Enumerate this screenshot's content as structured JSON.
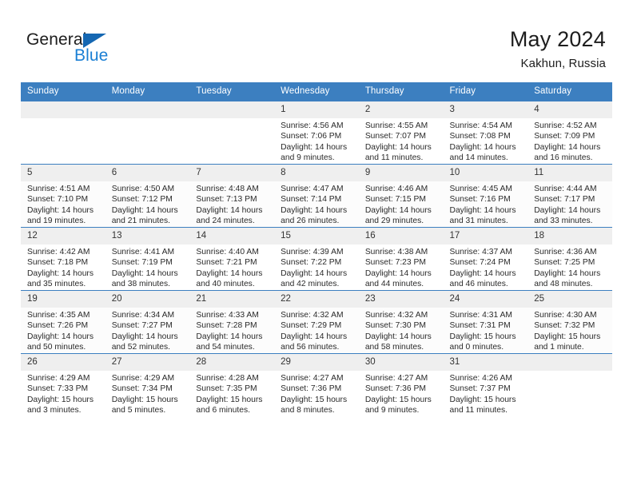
{
  "brand": {
    "name_part1": "General",
    "name_part2": "Blue",
    "triangle_color": "#1567b2",
    "blue_color": "#1a7fd4"
  },
  "title": {
    "month_year": "May 2024",
    "location": "Kakhun, Russia"
  },
  "theme": {
    "header_bg": "#3c7fc0",
    "header_text": "#ffffff",
    "daynum_bg": "#efefef",
    "row_alt_bg": "#fcfcfc",
    "grid_line": "#3c7fc0"
  },
  "weekdays": [
    "Sunday",
    "Monday",
    "Tuesday",
    "Wednesday",
    "Thursday",
    "Friday",
    "Saturday"
  ],
  "labels": {
    "sunrise_prefix": "Sunrise:",
    "sunset_prefix": "Sunset:",
    "daylight_prefix": "Daylight:"
  },
  "weeks": [
    [
      {
        "day": "",
        "empty": true
      },
      {
        "day": "",
        "empty": true
      },
      {
        "day": "",
        "empty": true
      },
      {
        "day": "1",
        "sunrise": "Sunrise: 4:56 AM",
        "sunset": "Sunset: 7:06 PM",
        "daylight_l1": "Daylight: 14 hours",
        "daylight_l2": "and 9 minutes."
      },
      {
        "day": "2",
        "sunrise": "Sunrise: 4:55 AM",
        "sunset": "Sunset: 7:07 PM",
        "daylight_l1": "Daylight: 14 hours",
        "daylight_l2": "and 11 minutes."
      },
      {
        "day": "3",
        "sunrise": "Sunrise: 4:54 AM",
        "sunset": "Sunset: 7:08 PM",
        "daylight_l1": "Daylight: 14 hours",
        "daylight_l2": "and 14 minutes."
      },
      {
        "day": "4",
        "sunrise": "Sunrise: 4:52 AM",
        "sunset": "Sunset: 7:09 PM",
        "daylight_l1": "Daylight: 14 hours",
        "daylight_l2": "and 16 minutes."
      }
    ],
    [
      {
        "day": "5",
        "sunrise": "Sunrise: 4:51 AM",
        "sunset": "Sunset: 7:10 PM",
        "daylight_l1": "Daylight: 14 hours",
        "daylight_l2": "and 19 minutes."
      },
      {
        "day": "6",
        "sunrise": "Sunrise: 4:50 AM",
        "sunset": "Sunset: 7:12 PM",
        "daylight_l1": "Daylight: 14 hours",
        "daylight_l2": "and 21 minutes."
      },
      {
        "day": "7",
        "sunrise": "Sunrise: 4:48 AM",
        "sunset": "Sunset: 7:13 PM",
        "daylight_l1": "Daylight: 14 hours",
        "daylight_l2": "and 24 minutes."
      },
      {
        "day": "8",
        "sunrise": "Sunrise: 4:47 AM",
        "sunset": "Sunset: 7:14 PM",
        "daylight_l1": "Daylight: 14 hours",
        "daylight_l2": "and 26 minutes."
      },
      {
        "day": "9",
        "sunrise": "Sunrise: 4:46 AM",
        "sunset": "Sunset: 7:15 PM",
        "daylight_l1": "Daylight: 14 hours",
        "daylight_l2": "and 29 minutes."
      },
      {
        "day": "10",
        "sunrise": "Sunrise: 4:45 AM",
        "sunset": "Sunset: 7:16 PM",
        "daylight_l1": "Daylight: 14 hours",
        "daylight_l2": "and 31 minutes."
      },
      {
        "day": "11",
        "sunrise": "Sunrise: 4:44 AM",
        "sunset": "Sunset: 7:17 PM",
        "daylight_l1": "Daylight: 14 hours",
        "daylight_l2": "and 33 minutes."
      }
    ],
    [
      {
        "day": "12",
        "sunrise": "Sunrise: 4:42 AM",
        "sunset": "Sunset: 7:18 PM",
        "daylight_l1": "Daylight: 14 hours",
        "daylight_l2": "and 35 minutes."
      },
      {
        "day": "13",
        "sunrise": "Sunrise: 4:41 AM",
        "sunset": "Sunset: 7:19 PM",
        "daylight_l1": "Daylight: 14 hours",
        "daylight_l2": "and 38 minutes."
      },
      {
        "day": "14",
        "sunrise": "Sunrise: 4:40 AM",
        "sunset": "Sunset: 7:21 PM",
        "daylight_l1": "Daylight: 14 hours",
        "daylight_l2": "and 40 minutes."
      },
      {
        "day": "15",
        "sunrise": "Sunrise: 4:39 AM",
        "sunset": "Sunset: 7:22 PM",
        "daylight_l1": "Daylight: 14 hours",
        "daylight_l2": "and 42 minutes."
      },
      {
        "day": "16",
        "sunrise": "Sunrise: 4:38 AM",
        "sunset": "Sunset: 7:23 PM",
        "daylight_l1": "Daylight: 14 hours",
        "daylight_l2": "and 44 minutes."
      },
      {
        "day": "17",
        "sunrise": "Sunrise: 4:37 AM",
        "sunset": "Sunset: 7:24 PM",
        "daylight_l1": "Daylight: 14 hours",
        "daylight_l2": "and 46 minutes."
      },
      {
        "day": "18",
        "sunrise": "Sunrise: 4:36 AM",
        "sunset": "Sunset: 7:25 PM",
        "daylight_l1": "Daylight: 14 hours",
        "daylight_l2": "and 48 minutes."
      }
    ],
    [
      {
        "day": "19",
        "sunrise": "Sunrise: 4:35 AM",
        "sunset": "Sunset: 7:26 PM",
        "daylight_l1": "Daylight: 14 hours",
        "daylight_l2": "and 50 minutes."
      },
      {
        "day": "20",
        "sunrise": "Sunrise: 4:34 AM",
        "sunset": "Sunset: 7:27 PM",
        "daylight_l1": "Daylight: 14 hours",
        "daylight_l2": "and 52 minutes."
      },
      {
        "day": "21",
        "sunrise": "Sunrise: 4:33 AM",
        "sunset": "Sunset: 7:28 PM",
        "daylight_l1": "Daylight: 14 hours",
        "daylight_l2": "and 54 minutes."
      },
      {
        "day": "22",
        "sunrise": "Sunrise: 4:32 AM",
        "sunset": "Sunset: 7:29 PM",
        "daylight_l1": "Daylight: 14 hours",
        "daylight_l2": "and 56 minutes."
      },
      {
        "day": "23",
        "sunrise": "Sunrise: 4:32 AM",
        "sunset": "Sunset: 7:30 PM",
        "daylight_l1": "Daylight: 14 hours",
        "daylight_l2": "and 58 minutes."
      },
      {
        "day": "24",
        "sunrise": "Sunrise: 4:31 AM",
        "sunset": "Sunset: 7:31 PM",
        "daylight_l1": "Daylight: 15 hours",
        "daylight_l2": "and 0 minutes."
      },
      {
        "day": "25",
        "sunrise": "Sunrise: 4:30 AM",
        "sunset": "Sunset: 7:32 PM",
        "daylight_l1": "Daylight: 15 hours",
        "daylight_l2": "and 1 minute."
      }
    ],
    [
      {
        "day": "26",
        "sunrise": "Sunrise: 4:29 AM",
        "sunset": "Sunset: 7:33 PM",
        "daylight_l1": "Daylight: 15 hours",
        "daylight_l2": "and 3 minutes."
      },
      {
        "day": "27",
        "sunrise": "Sunrise: 4:29 AM",
        "sunset": "Sunset: 7:34 PM",
        "daylight_l1": "Daylight: 15 hours",
        "daylight_l2": "and 5 minutes."
      },
      {
        "day": "28",
        "sunrise": "Sunrise: 4:28 AM",
        "sunset": "Sunset: 7:35 PM",
        "daylight_l1": "Daylight: 15 hours",
        "daylight_l2": "and 6 minutes."
      },
      {
        "day": "29",
        "sunrise": "Sunrise: 4:27 AM",
        "sunset": "Sunset: 7:36 PM",
        "daylight_l1": "Daylight: 15 hours",
        "daylight_l2": "and 8 minutes."
      },
      {
        "day": "30",
        "sunrise": "Sunrise: 4:27 AM",
        "sunset": "Sunset: 7:36 PM",
        "daylight_l1": "Daylight: 15 hours",
        "daylight_l2": "and 9 minutes."
      },
      {
        "day": "31",
        "sunrise": "Sunrise: 4:26 AM",
        "sunset": "Sunset: 7:37 PM",
        "daylight_l1": "Daylight: 15 hours",
        "daylight_l2": "and 11 minutes."
      },
      {
        "day": "",
        "empty": true
      }
    ]
  ]
}
